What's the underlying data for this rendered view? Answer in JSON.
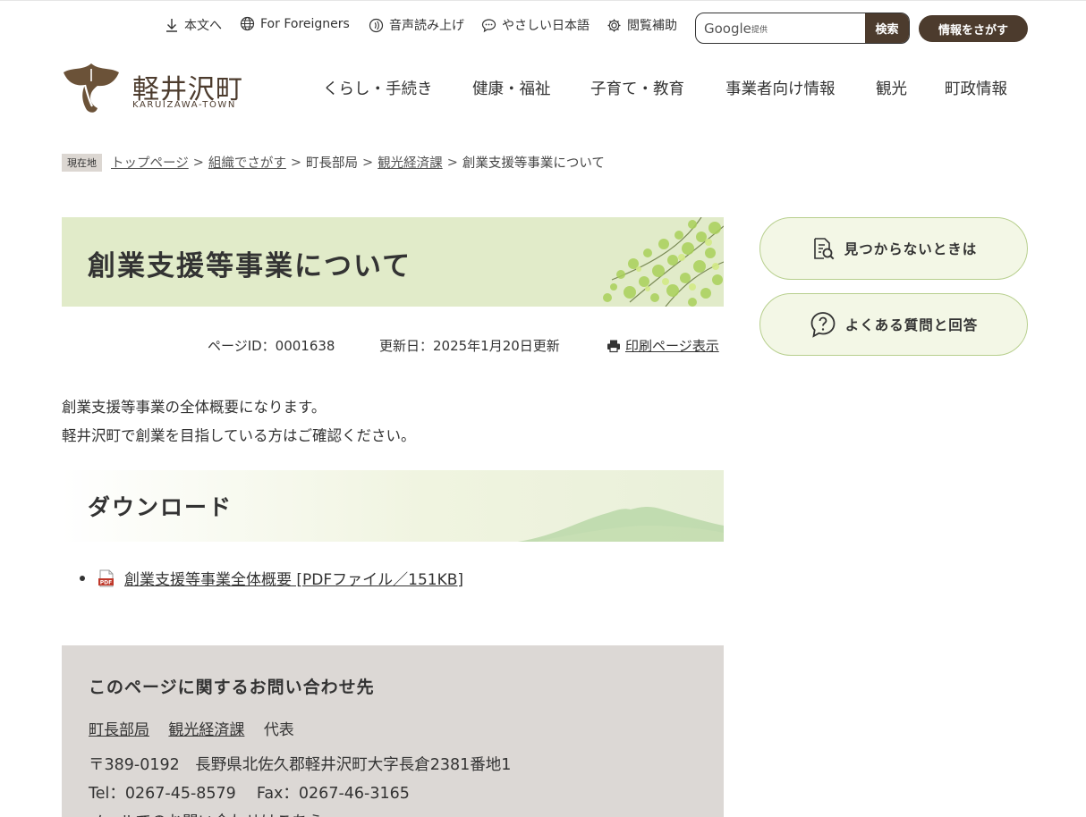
{
  "utility": {
    "skip": "本文へ",
    "foreigners": "For Foreigners",
    "voice": "音声読み上げ",
    "easy_japanese": "やさしい日本語",
    "accessibility": "閲覧補助",
    "search_placeholder": "Google",
    "search_hint": "提供",
    "search_button": "検索",
    "find_button": "情報をさがす"
  },
  "logo": {
    "title": "軽井沢町",
    "subtitle": "KARUIZAWA-TOWN"
  },
  "gnav": [
    "くらし・手続き",
    "健康・福祉",
    "子育て・教育",
    "事業者向け情報",
    "観光",
    "町政情報"
  ],
  "breadcrumb": {
    "label": "現在地",
    "items": [
      "トップページ",
      "組織でさがす",
      "町長部局",
      "観光経済課",
      "創業支援等事業について"
    ],
    "separator": ">"
  },
  "page": {
    "title": "創業支援等事業について",
    "page_id": "ページID：0001638",
    "updated": "更新日：2025年1月20日更新",
    "print": "印刷ページ表示",
    "intro_line1": "創業支援等事業の全体概要になります。",
    "intro_line2": "軽井沢町で創業を目指している方はご確認ください。",
    "download_heading": "ダウンロード",
    "download_link": "創業支援等事業全体概要 [PDFファイル／151KB]",
    "pdf_label": "PDF"
  },
  "contact": {
    "heading": "このページに関するお問い合わせ先",
    "dept1": "町長部局",
    "dept2": "観光経済課",
    "dept3": "代表",
    "address": "〒389-0192　長野県北佐久郡軽井沢町大字長倉2381番地1",
    "tel": "Tel：0267-45-8579　 Fax：0267-46-3165",
    "mail": "メールでのお問い合わせはこちら"
  },
  "side": {
    "not_found": "見つからないときは",
    "faq": "よくある質問と回答"
  },
  "colors": {
    "brand_brown": "#4c3b2d",
    "title_green": "#e1ebc9",
    "contact_gray": "#dcd8d5"
  }
}
